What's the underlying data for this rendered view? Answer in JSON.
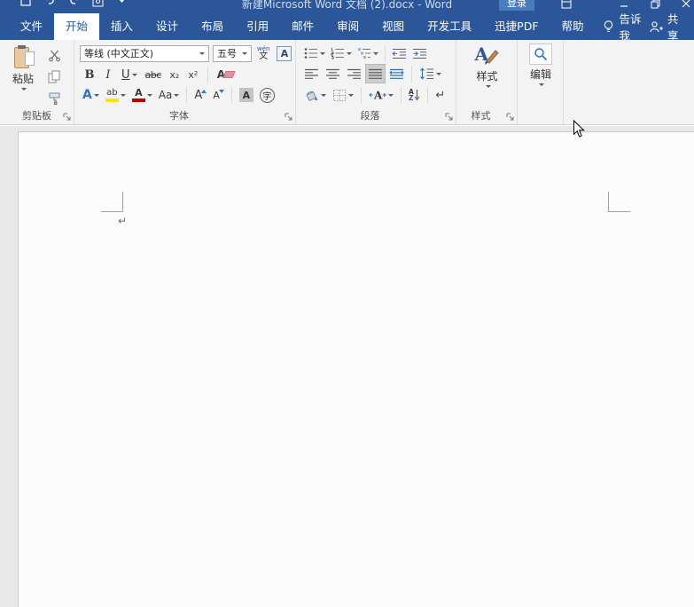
{
  "titlebar": {
    "title": "新建Microsoft Word 文档 (2).docx - Word",
    "sign_in": "登录"
  },
  "tabs": [
    {
      "label": "文件"
    },
    {
      "label": "开始",
      "active": true
    },
    {
      "label": "插入"
    },
    {
      "label": "设计"
    },
    {
      "label": "布局"
    },
    {
      "label": "引用"
    },
    {
      "label": "邮件"
    },
    {
      "label": "审阅"
    },
    {
      "label": "视图"
    },
    {
      "label": "开发工具"
    },
    {
      "label": "迅捷PDF"
    },
    {
      "label": "帮助"
    }
  ],
  "help_area": {
    "tell_me": "告诉我",
    "share": "共享"
  },
  "ribbon": {
    "clipboard": {
      "label": "剪贴板",
      "paste": "粘贴"
    },
    "font": {
      "label": "字体",
      "name": "等线 (中文正文)",
      "size": "五号",
      "bold": "B",
      "italic": "I",
      "underline": "U",
      "strike": "abc",
      "subscript": "x₂",
      "superscript": "x²",
      "clear": "A",
      "effects": "A",
      "highlight": "ab",
      "color": "A",
      "case": "Aa",
      "grow": "A",
      "shrink": "A",
      "shade": "A",
      "enclose": "字",
      "phonetic_top": "wén",
      "phonetic_bottom": "文",
      "char_border": "A"
    },
    "paragraph": {
      "label": "段落",
      "sort_a": "A",
      "sort_z": "Z",
      "show_mark": "↵"
    },
    "styles": {
      "label": "样式",
      "button": "样式",
      "icon_glyph": "A"
    },
    "editing": {
      "button": "编辑"
    }
  },
  "document": {
    "paragraph_mark": "↵"
  },
  "colors": {
    "titlebar_blue": "#2b579a",
    "ribbon_bg": "#f3f3f3",
    "active_tab_text": "#2b579a",
    "font_color_red": "#c00000",
    "highlight_yellow": "#ffe400",
    "canvas_gray": "#e8e8e8",
    "page_white": "#fcfcfc",
    "selected_button_gray": "#cdcdcd"
  }
}
